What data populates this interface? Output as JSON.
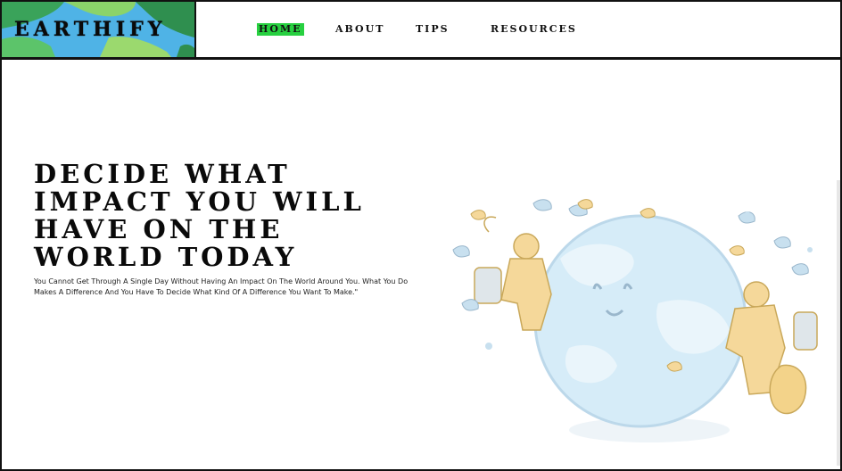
{
  "header": {
    "brand": "EARTHIFY",
    "nav": [
      {
        "label": "HOME",
        "active": true
      },
      {
        "label": "ABOUT",
        "active": false
      },
      {
        "label": "TIPS",
        "active": false
      },
      {
        "label": "RESOURCES",
        "active": false
      }
    ]
  },
  "hero": {
    "title": "Decide What Impact You Will Have On The World Today",
    "subtitle": "You Cannot Get Through A Single Day Without Having An Impact On The World Around You. What You Do Makes A Difference And You Have To Decide What Kind Of A Difference You Want To Make.\"",
    "illustration": "earth-with-astronauts-illustration"
  },
  "colors": {
    "nav_active": "#27d040",
    "globe": "#cfe8f5",
    "astronaut": "#f5d89a"
  }
}
